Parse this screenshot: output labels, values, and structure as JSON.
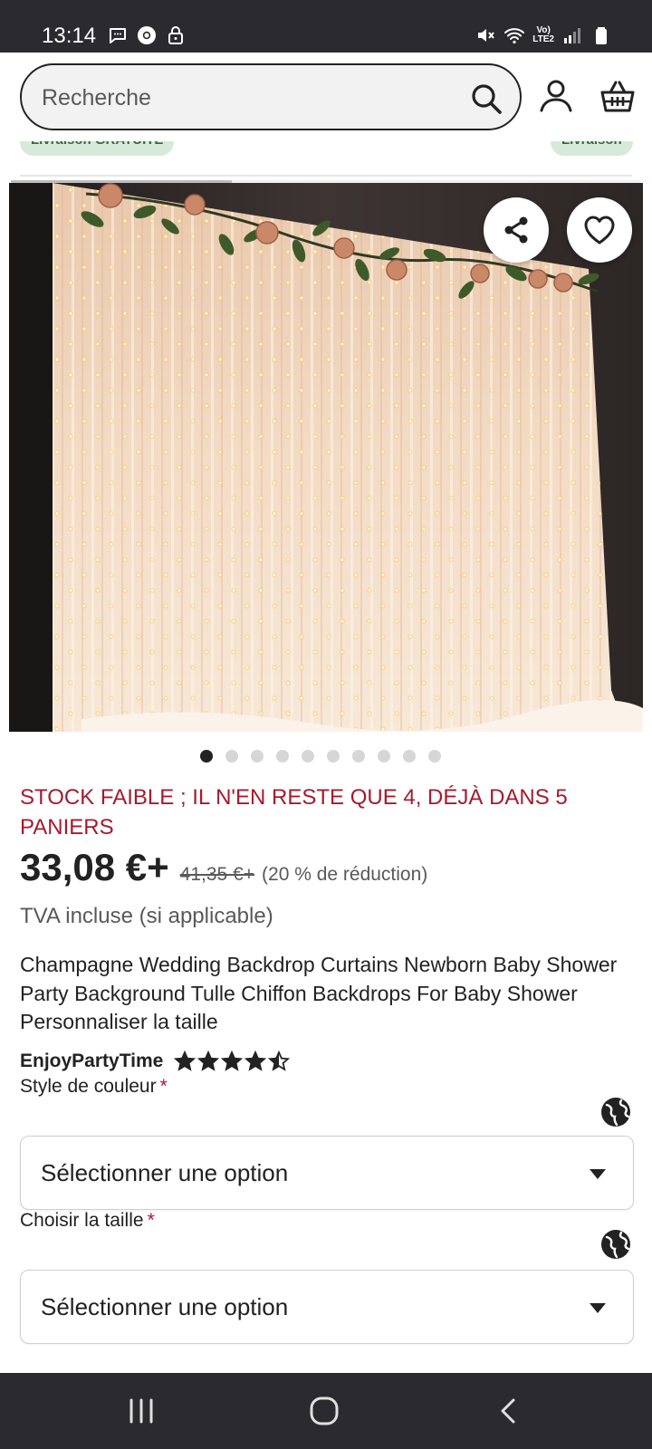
{
  "status_bar": {
    "time": "13:14",
    "net_label_top": "Vo)",
    "net_label_bottom": "LTE2"
  },
  "header": {
    "search": {
      "placeholder": "Recherche"
    }
  },
  "chips": {
    "left": "Livraison GRATUITE",
    "right": "Livraison"
  },
  "image_carousel": {
    "total": 10,
    "active_index": 0
  },
  "product": {
    "stock_alert": "STOCK FAIBLE ; IL N'EN RESTE QUE 4, DÉJÀ DANS 5 PANIERS",
    "price": "33,08 €+",
    "original_price": "41,35 €+",
    "discount": "(20 % de réduction)",
    "vat_note": "TVA incluse (si applicable)",
    "title": "Champagne Wedding Backdrop Curtains Newborn Baby Shower Party Background Tulle Chiffon Backdrops For Baby Shower Personnaliser la taille",
    "shop_name": "EnjoyPartyTime",
    "rating_stars": 4.5
  },
  "options": [
    {
      "label": "Style de couleur",
      "required_mark": "*",
      "value": "Sélectionner une option"
    },
    {
      "label": "Choisir la taille",
      "required_mark": "*",
      "value": "Sélectionner une option"
    }
  ],
  "colors": {
    "alert": "#a61a2e",
    "text": "#222222",
    "muted": "#595959",
    "chip_bg": "#d7ead9",
    "bars": "#2b2b2f"
  }
}
